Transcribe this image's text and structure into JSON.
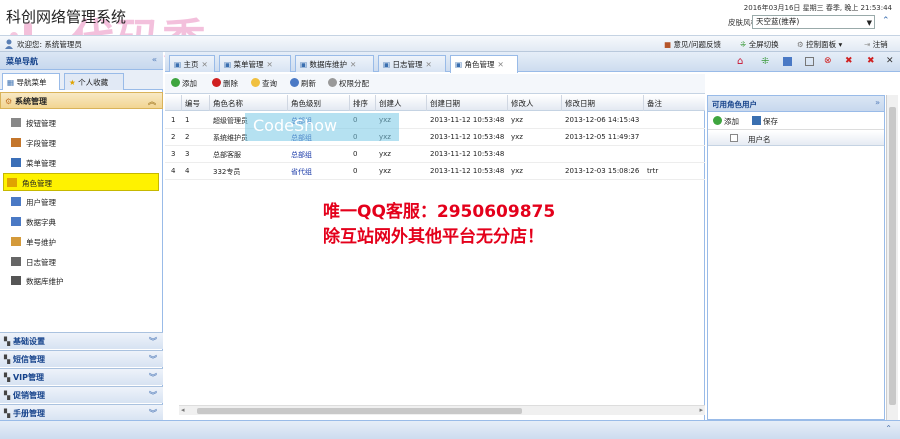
{
  "header": {
    "title": "科创网络管理系统",
    "watermark": "代码秀",
    "datetime": "2016年03月16日 星期三 春季, 晚上 21:53:44",
    "skin_label": "皮肤风格:",
    "skin_value": "天空蓝(推荐)"
  },
  "welcome": {
    "text": "欢迎您: 系统管理员",
    "actions": [
      "意见/问题反馈",
      "全屏切换",
      "控制面板",
      "注销"
    ]
  },
  "sidebar": {
    "title": "菜单导航",
    "tabs": [
      "导航菜单",
      "个人收藏"
    ],
    "system_section": "系统管理",
    "items": [
      {
        "label": "按钮管理",
        "icon": "cursor-icon",
        "color": "#888"
      },
      {
        "label": "字段管理",
        "icon": "edit-icon",
        "color": "#c4762b"
      },
      {
        "label": "菜单管理",
        "icon": "book-icon",
        "color": "#3b6fb8"
      },
      {
        "label": "角色管理",
        "icon": "folder-icon",
        "color": "#e0a400"
      },
      {
        "label": "用户管理",
        "icon": "user-icon",
        "color": "#4a79c5"
      },
      {
        "label": "数据字典",
        "icon": "dictionary-icon",
        "color": "#4a79c5"
      },
      {
        "label": "单号维护",
        "icon": "document-icon",
        "color": "#d49a3a"
      },
      {
        "label": "日志管理",
        "icon": "log-icon",
        "color": "#666"
      },
      {
        "label": "数据库维护",
        "icon": "database-icon",
        "color": "#555"
      }
    ],
    "collapsed_sections": [
      "基础设置",
      "短信管理",
      "VIP管理",
      "促销管理",
      "手册管理"
    ]
  },
  "tabs": [
    {
      "label": "主页",
      "icon": "home-icon"
    },
    {
      "label": "菜单管理",
      "icon": "book-icon"
    },
    {
      "label": "数据库维护",
      "icon": "database-icon"
    },
    {
      "label": "日志管理",
      "icon": "log-icon"
    },
    {
      "label": "角色管理",
      "icon": "folder-icon"
    }
  ],
  "toolbar": [
    "添加",
    "删除",
    "查询",
    "刷新",
    "权限分配"
  ],
  "grid": {
    "columns": [
      "编号",
      "角色名称",
      "角色级别",
      "排序",
      "创建人",
      "创建日期",
      "修改人",
      "修改日期",
      "备注"
    ],
    "rows": [
      {
        "idx": "1",
        "no": "1",
        "name": "超级管理员",
        "level": "总部组",
        "sort": "0",
        "creator": "yxz",
        "created": "2013-11-12 10:53:48",
        "modifier": "yxz",
        "modified": "2013-12-06 14:15:43",
        "remark": ""
      },
      {
        "idx": "2",
        "no": "2",
        "name": "系统维护员",
        "level": "总部组",
        "sort": "0",
        "creator": "yxz",
        "created": "2013-11-12 10:53:48",
        "modifier": "yxz",
        "modified": "2013-12-05 11:49:37",
        "remark": ""
      },
      {
        "idx": "3",
        "no": "3",
        "name": "总部客服",
        "level": "总部组",
        "sort": "0",
        "creator": "yxz",
        "created": "2013-11-12 10:53:48",
        "modifier": "",
        "modified": "",
        "remark": ""
      },
      {
        "idx": "4",
        "no": "4",
        "name": "332专员",
        "level": "省代组",
        "sort": "0",
        "creator": "yxz",
        "created": "2013-11-12 10:53:48",
        "modifier": "yxz",
        "modified": "2013-12-03 15:08:26",
        "remark": "trtr"
      }
    ]
  },
  "right_panel": {
    "title": "可用角色用户",
    "actions": [
      "添加",
      "保存"
    ],
    "column": "用户名"
  },
  "overlay": {
    "codeshow": "CodeShow",
    "promo1": "唯一QQ客服：2950609875",
    "promo2": "除互站网外其他平台无分店！"
  }
}
